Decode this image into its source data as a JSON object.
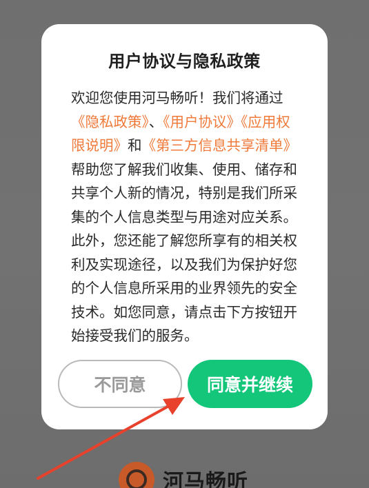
{
  "dialog": {
    "title": "用户协议与隐私政策",
    "body": {
      "intro": "欢迎您使用河马畅听！我们将通过",
      "link_privacy": "《隐私政策》",
      "sep1": "、",
      "link_user_agreement": "《用户协议》",
      "link_permissions": "《应用权限说明》",
      "and": "和",
      "link_third_party": "《第三方信息共享清单》",
      "rest": "帮助您了解我们收集、使用、储存和共享个人新的情况，特别是我们所采集的个人信息类型与用途对应关系。此外，您还能了解您所享有的相关权利及实现途径，以及我们为保护好您的个人信息所采用的业界领先的安全技术。如您同意，请点击下方按钮开始接受我们的服务。"
    },
    "decline_label": "不同意",
    "accept_label": "同意并继续"
  },
  "brand": {
    "name": "河马畅听",
    "logo_icon": "headphones-logo-icon"
  },
  "annotation": {
    "arrow_icon": "red-arrow-icon",
    "arrow_color": "#e8412c"
  },
  "colors": {
    "link": "#f07a3a",
    "accept_button": "#13c67a",
    "overlay": "#707070"
  }
}
